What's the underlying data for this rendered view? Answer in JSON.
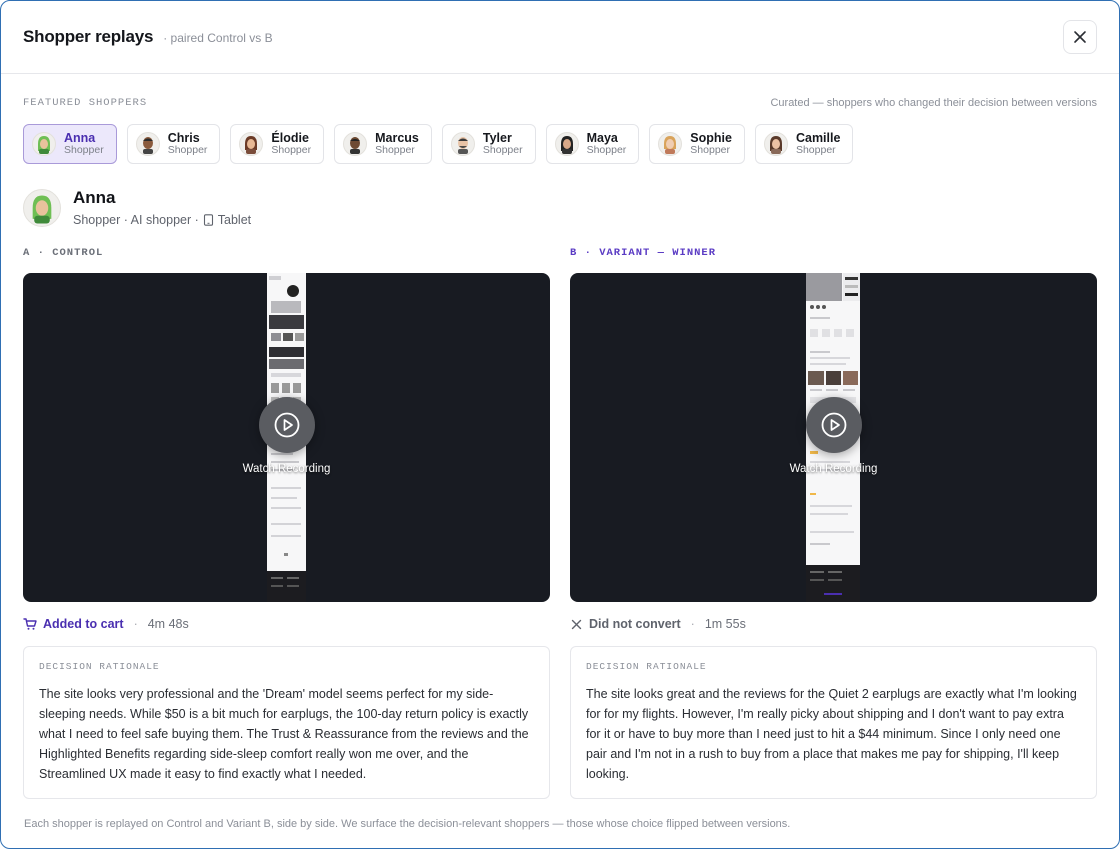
{
  "header": {
    "title": "Shopper replays",
    "subtitle": "· paired Control vs B",
    "close_icon": "close-icon"
  },
  "featured": {
    "title": "FEATURED SHOPPERS",
    "note": "Curated — shoppers who changed their decision between versions",
    "chips": [
      {
        "name": "Anna",
        "role": "Shopper",
        "active": true
      },
      {
        "name": "Chris",
        "role": "Shopper"
      },
      {
        "name": "Élodie",
        "role": "Shopper"
      },
      {
        "name": "Marcus",
        "role": "Shopper"
      },
      {
        "name": "Tyler",
        "role": "Shopper"
      },
      {
        "name": "Maya",
        "role": "Shopper"
      },
      {
        "name": "Sophie",
        "role": "Shopper"
      },
      {
        "name": "Camille",
        "role": "Shopper"
      }
    ]
  },
  "profile": {
    "name": "Anna",
    "meta_prefix": "Shopper · AI shopper ·",
    "device": "Tablet",
    "device_icon": "tablet-icon"
  },
  "control": {
    "label": "A · CONTROL",
    "watch_label": "Watch Recording",
    "outcome_icon": "cart-icon",
    "outcome": "Added to cart",
    "sep": "·",
    "duration": "4m 48s",
    "rationale_title": "DECISION RATIONALE",
    "rationale": "The site looks very professional and the 'Dream' model seems perfect for my side-sleeping needs. While $50 is a bit much for earplugs, the 100-day return policy is exactly what I need to feel safe buying them. The Trust & Reassurance from the reviews and the Highlighted Benefits regarding side-sleep comfort really won me over, and the Streamlined UX made it easy to find exactly what I needed."
  },
  "variant": {
    "label": "B · VARIANT — WINNER",
    "watch_label": "Watch Recording",
    "outcome_icon": "x-icon",
    "outcome": "Did not convert",
    "sep": "·",
    "duration": "1m 55s",
    "rationale_title": "DECISION RATIONALE",
    "rationale": "The site looks great and the reviews for the Quiet 2 earplugs are exactly what I'm looking for for my flights. However, I'm really picky about shipping and I don't want to pay extra for it or have to buy more than I need just to hit a $44 minimum. Since I only need one pair and I'm not in a rush to buy from a place that makes me pay for shipping, I'll keep looking."
  },
  "footnote": "Each shopper is replayed on Control and Variant B, side by side. We surface the decision-relevant shoppers — those whose choice flipped between versions.",
  "colors": {
    "accent": "#4a2fb0",
    "active_chip_bg": "#ece8fb",
    "video_bg": "#181b22"
  }
}
